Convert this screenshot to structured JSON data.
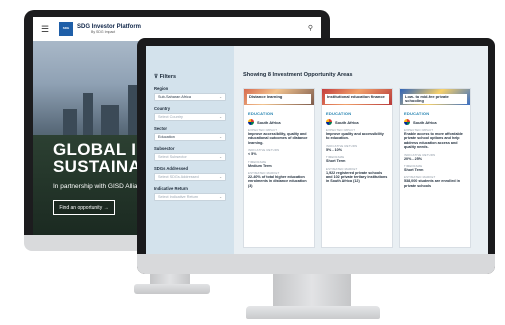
{
  "back_site": {
    "brand_title": "SDG Investor Platform",
    "brand_sub": "By SDG Impact",
    "hero_line1": "GLOBAL INVEST",
    "hero_line2": "SUSTAINABLE D",
    "hero_sub": "In partnership with GISD Alliance",
    "cta": "Find an opportunity  →",
    "icons": {
      "menu": "menu-icon",
      "user": "user-icon"
    }
  },
  "filters": {
    "title": "Filters",
    "groups": [
      {
        "label": "Region",
        "value": "Sub-Saharan Africa",
        "placeholder": false
      },
      {
        "label": "Country",
        "value": "Select Country",
        "placeholder": true
      },
      {
        "label": "Sector",
        "value": "Education",
        "placeholder": false
      },
      {
        "label": "Subsector",
        "value": "Select Subsector",
        "placeholder": true
      },
      {
        "label": "SDGs Addressed",
        "value": "Select SDGs Addressed",
        "placeholder": true
      },
      {
        "label": "Indicative Return",
        "value": "Select Indicative Return",
        "placeholder": true
      }
    ]
  },
  "main": {
    "heading": "Showing 8 Investment Opportunity Areas",
    "cards": [
      {
        "title": "Distance learning",
        "category": "EDUCATION",
        "country": "South Africa",
        "k1": "EXPECTED IMPACT",
        "v1": "Improve accessibility, quality and educational outcomes of distance learning.",
        "k2": "INDICATIVE RETURN",
        "v2": "< 5%",
        "k3": "TIMEFRAME",
        "v3": "Medium Term",
        "k4": "ESTIMATED MARKET",
        "v4": "22-40% of total higher education enrolments in distance education (3)"
      },
      {
        "title": "Institutional education finance",
        "category": "EDUCATION",
        "country": "South Africa",
        "k1": "EXPECTED IMPACT",
        "v1": "Improve quality and accessibility to education.",
        "k2": "INDICATIVE RETURN",
        "v2": "5% - 10%",
        "k3": "TIMEFRAME",
        "v3": "Short Term",
        "k4": "ESTIMATED MARKET",
        "v4": "1,922 registered private schools and 102 private tertiary institutions in South Africa (12)"
      },
      {
        "title": "Low- to mid-fee private schooling",
        "category": "EDUCATION",
        "country": "South Africa",
        "k1": "EXPECTED IMPACT",
        "v1": "Enable access to more affordable private school options and help address education access and quality needs.",
        "k2": "INDICATIVE RETURN",
        "v2": "20% - 25%",
        "k3": "TIMEFRAME",
        "v3": "Short Term",
        "k4": "ESTIMATED MARKET",
        "v4": "538,000 students are enrolled in private schools"
      }
    ]
  },
  "colors": {
    "accent": "#1e7fae",
    "sidebar": "#d3e2ec",
    "bezel": "#1a1a1c"
  }
}
